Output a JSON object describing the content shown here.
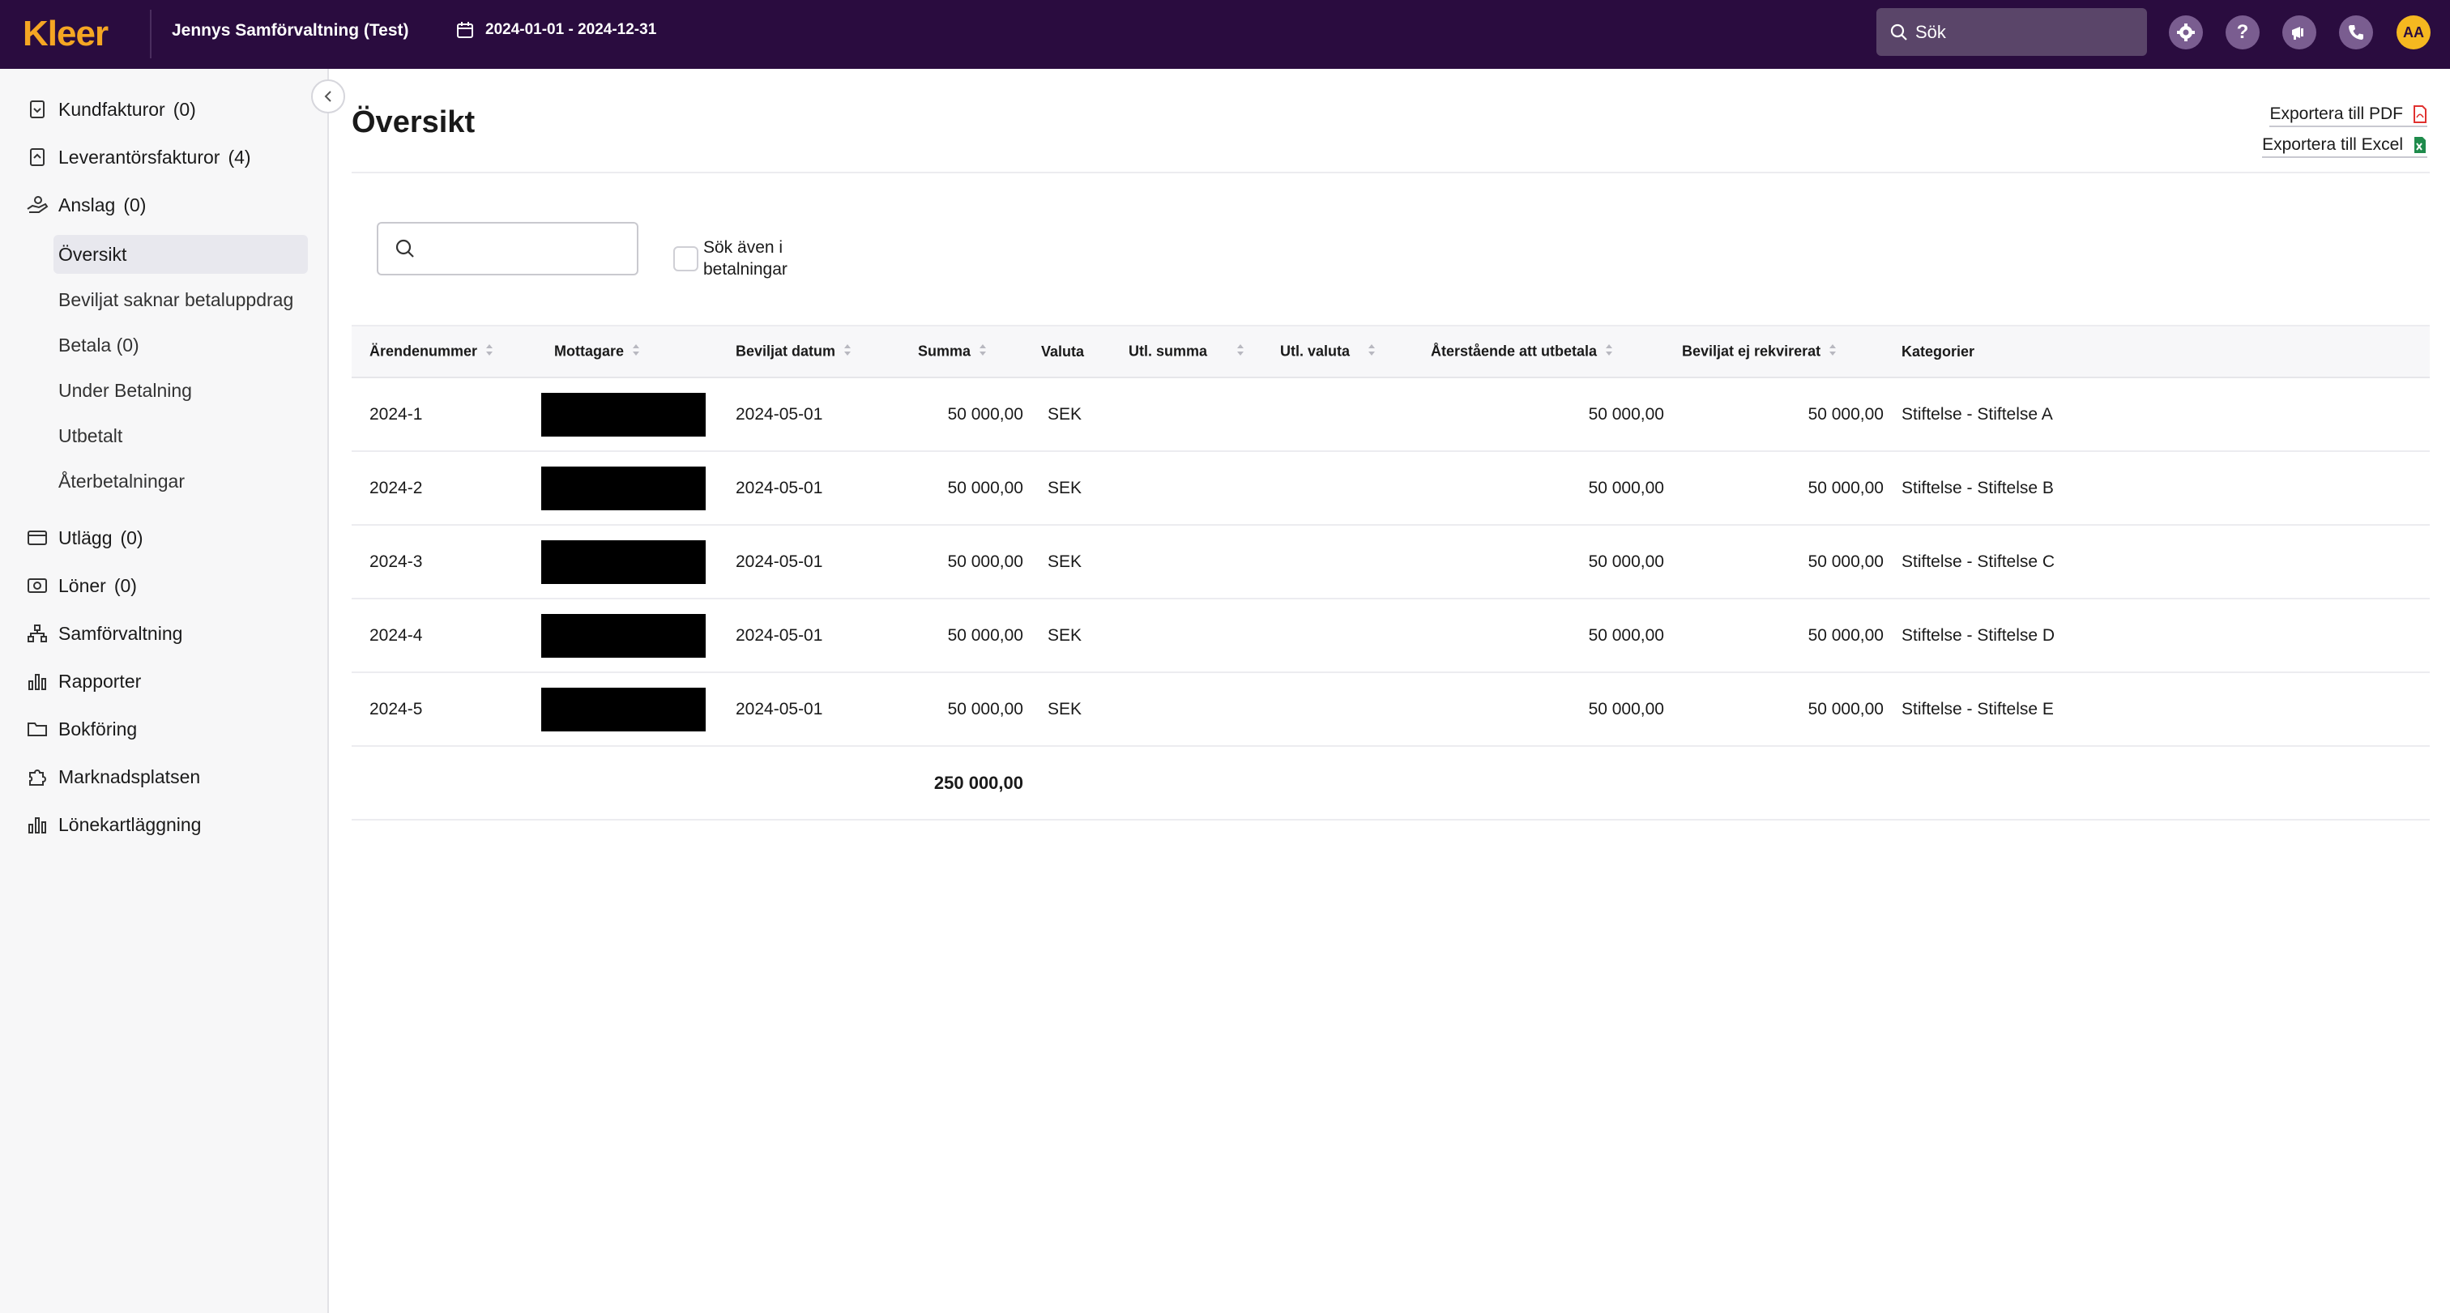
{
  "app": {
    "logo": "Kleer",
    "org_name": "Jennys Samförvaltning (Test)",
    "date_range": "2024-01-01 - 2024-12-31",
    "search_placeholder": "Sök",
    "avatar_initials": "AA",
    "brand_color": "#f5a623",
    "topbar_color": "#2a0c3f"
  },
  "sidebar": {
    "items": [
      {
        "label": "Kundfakturor",
        "count": "(0)",
        "icon": "invoice-icon"
      },
      {
        "label": "Leverantörsfakturor",
        "count": "(4)",
        "icon": "supplier-invoice-icon"
      },
      {
        "label": "Anslag",
        "count": "(0)",
        "icon": "grant-hand-icon"
      },
      {
        "label": "Utlägg",
        "count": "(0)",
        "icon": "card-icon"
      },
      {
        "label": "Löner",
        "count": "(0)",
        "icon": "money-icon"
      },
      {
        "label": "Samförvaltning",
        "icon": "org-tree-icon"
      },
      {
        "label": "Rapporter",
        "icon": "bar-chart-icon"
      },
      {
        "label": "Bokföring",
        "icon": "folder-icon"
      },
      {
        "label": "Marknadsplatsen",
        "icon": "puzzle-icon"
      },
      {
        "label": "Lönekartläggning",
        "icon": "bar-chart-icon"
      }
    ],
    "sub_items": [
      {
        "label": "Översikt",
        "active": true
      },
      {
        "label": "Beviljat saknar betaluppdrag"
      },
      {
        "label": "Betala (0)"
      },
      {
        "label": "Under Betalning"
      },
      {
        "label": "Utbetalt"
      },
      {
        "label": "Återbetalningar"
      }
    ]
  },
  "main": {
    "title": "Översikt",
    "export_pdf": "Exportera till PDF",
    "export_excel": "Exportera till Excel",
    "search_also_label": "Sök även i betalningar",
    "columns": [
      "Ärendenummer",
      "Mottagare",
      "Beviljat datum",
      "Summa",
      "Valuta",
      "Utl. summa",
      "Utl. valuta",
      "Återstående att utbetala",
      "Beviljat ej rekvirerat",
      "Kategorier"
    ],
    "rows": [
      {
        "case": "2024-1",
        "date": "2024-05-01",
        "sum": "50 000,00",
        "currency": "SEK",
        "remaining": "50 000,00",
        "not_requested": "50 000,00",
        "category": "Stiftelse - Stiftelse A"
      },
      {
        "case": "2024-2",
        "date": "2024-05-01",
        "sum": "50 000,00",
        "currency": "SEK",
        "remaining": "50 000,00",
        "not_requested": "50 000,00",
        "category": "Stiftelse - Stiftelse B"
      },
      {
        "case": "2024-3",
        "date": "2024-05-01",
        "sum": "50 000,00",
        "currency": "SEK",
        "remaining": "50 000,00",
        "not_requested": "50 000,00",
        "category": "Stiftelse - Stiftelse C"
      },
      {
        "case": "2024-4",
        "date": "2024-05-01",
        "sum": "50 000,00",
        "currency": "SEK",
        "remaining": "50 000,00",
        "not_requested": "50 000,00",
        "category": "Stiftelse - Stiftelse D"
      },
      {
        "case": "2024-5",
        "date": "2024-05-01",
        "sum": "50 000,00",
        "currency": "SEK",
        "remaining": "50 000,00",
        "not_requested": "50 000,00",
        "category": "Stiftelse - Stiftelse E"
      }
    ],
    "total_sum": "250 000,00"
  }
}
